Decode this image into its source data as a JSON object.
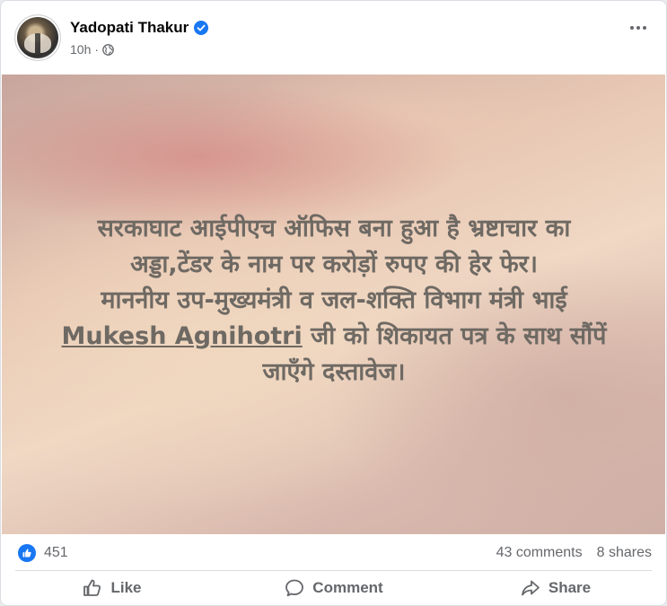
{
  "post": {
    "author": "Yadopati Thakur",
    "time": "10h",
    "separator": "·",
    "content_lines": [
      "सरकाघाट आईपीएच ऑफिस बना हुआ है भ्रष्टाचार का",
      "अड्डा,टेंडर के नाम पर करोड़ों रुपए की हेर फेर।",
      "माननीय उप-मुख्यमंत्री व जल-शक्ति विभाग मंत्री भाई"
    ],
    "mention": "Mukesh Agnihotri",
    "line4_rest": " जी को शिकायत पत्र के साथ सौंपें",
    "line5": "जाएँगे दस्तावेज।"
  },
  "stats": {
    "likes": "451",
    "comments": "43 comments",
    "shares": "8 shares"
  },
  "actions": {
    "like": "Like",
    "comment": "Comment",
    "share": "Share"
  },
  "colors": {
    "brand_blue": "#1877f2",
    "secondary_text": "#65676b",
    "post_text": "#6e6963"
  },
  "icons": {
    "verified": "verified-badge-icon",
    "audience": "globe-icon",
    "menu": "more-options-icon",
    "reaction": "like-reaction-icon",
    "like": "thumbs-up-icon",
    "comment": "comment-bubble-icon",
    "share": "share-arrow-icon"
  }
}
